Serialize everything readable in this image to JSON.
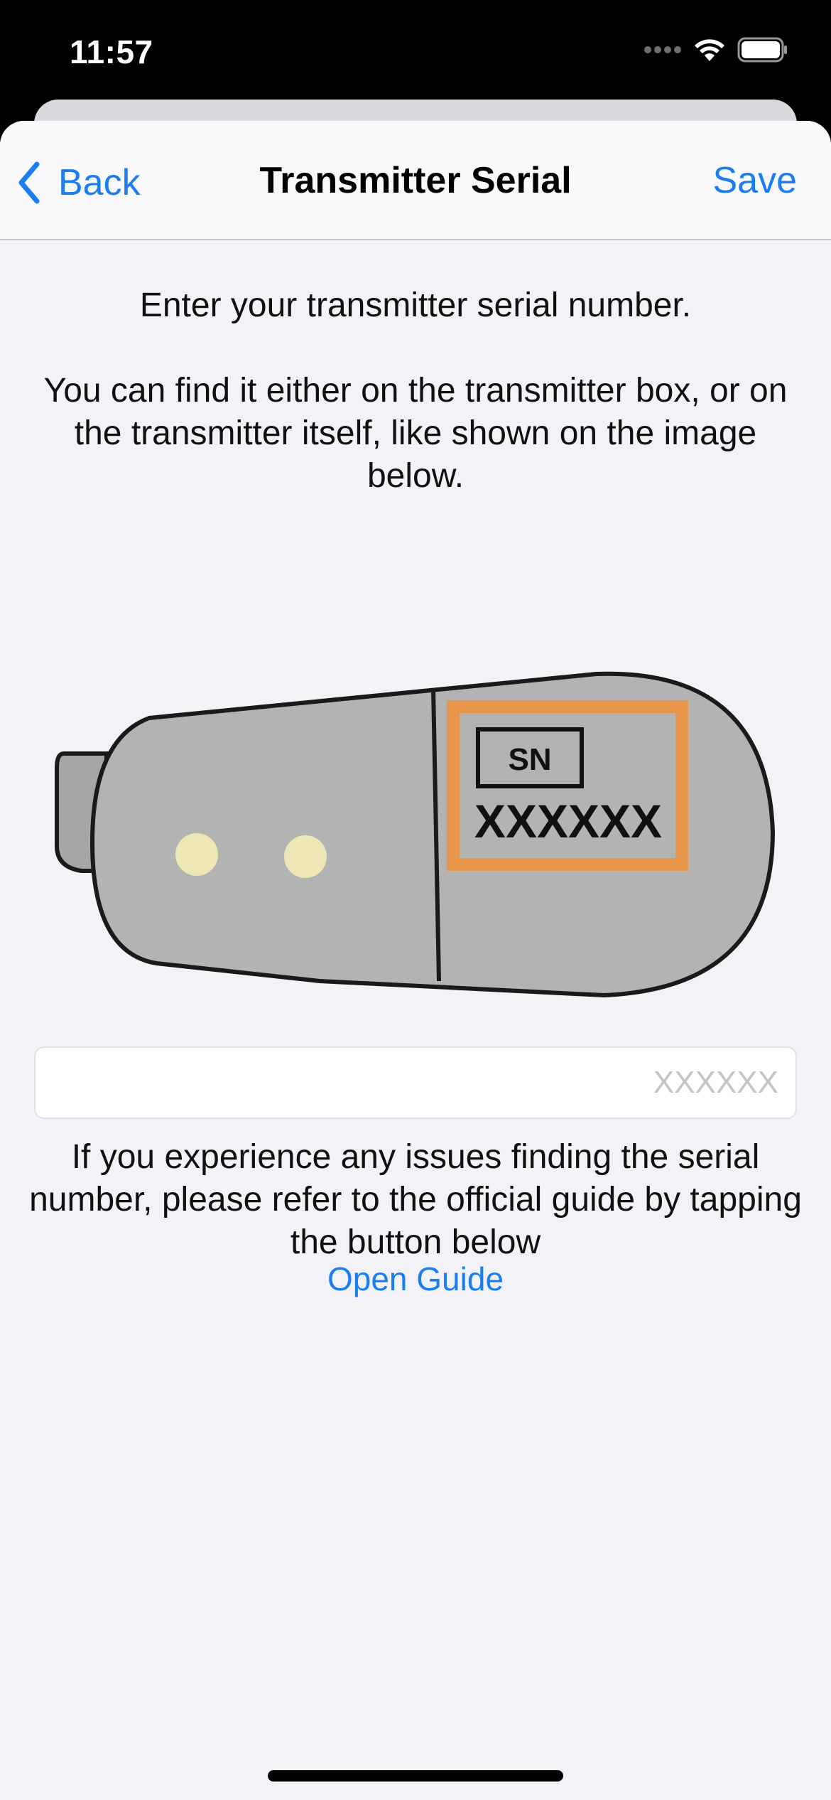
{
  "status_bar": {
    "time": "11:57",
    "icons": [
      "signal-dots-icon",
      "wifi-icon",
      "battery-icon"
    ]
  },
  "nav": {
    "back_label": "Back",
    "title": "Transmitter Serial",
    "save_label": "Save"
  },
  "instructions": {
    "line1": "Enter your transmitter serial number.",
    "line2": "You can find it either on the transmitter box, or on the transmitter itself, like shown on the image below."
  },
  "illustration": {
    "sn_label": "SN",
    "serial_sample": "XXXXXX",
    "highlight_color": "#e8964c"
  },
  "serial_input": {
    "value": "",
    "placeholder": "XXXXXX"
  },
  "help_text": "If you experience any issues finding the serial number, please refer to the official guide by tapping the button below",
  "open_guide_label": "Open Guide",
  "colors": {
    "accent": "#1a7ef0",
    "background": "#f2f2f7"
  }
}
